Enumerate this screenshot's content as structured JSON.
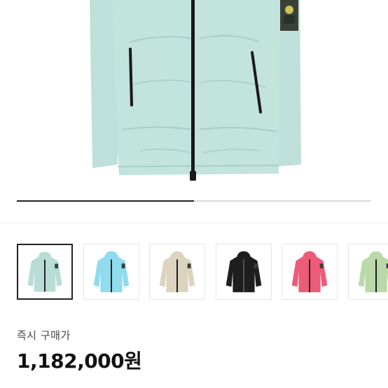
{
  "gallery": {
    "progress_fraction": 0.5,
    "thumbnails": [
      {
        "name": "thumbnail-mint",
        "color": "#b8dcd6",
        "selected": true
      },
      {
        "name": "thumbnail-sky",
        "color": "#8fdcef",
        "selected": false
      },
      {
        "name": "thumbnail-beige",
        "color": "#ddd4c0",
        "selected": false
      },
      {
        "name": "thumbnail-black",
        "color": "#1e1e1e",
        "selected": false
      },
      {
        "name": "thumbnail-pink",
        "color": "#ec5c78",
        "selected": false
      },
      {
        "name": "thumbnail-sage",
        "color": "#b9d9a8",
        "selected": false
      }
    ]
  },
  "colors": {
    "hero_jacket": "#bfe0da",
    "hero_jacket_shadow": "#a9cec7",
    "zipper": "#1a1a1a"
  },
  "purchase": {
    "label": "즉시 구매가",
    "price": "1,182,000원"
  }
}
